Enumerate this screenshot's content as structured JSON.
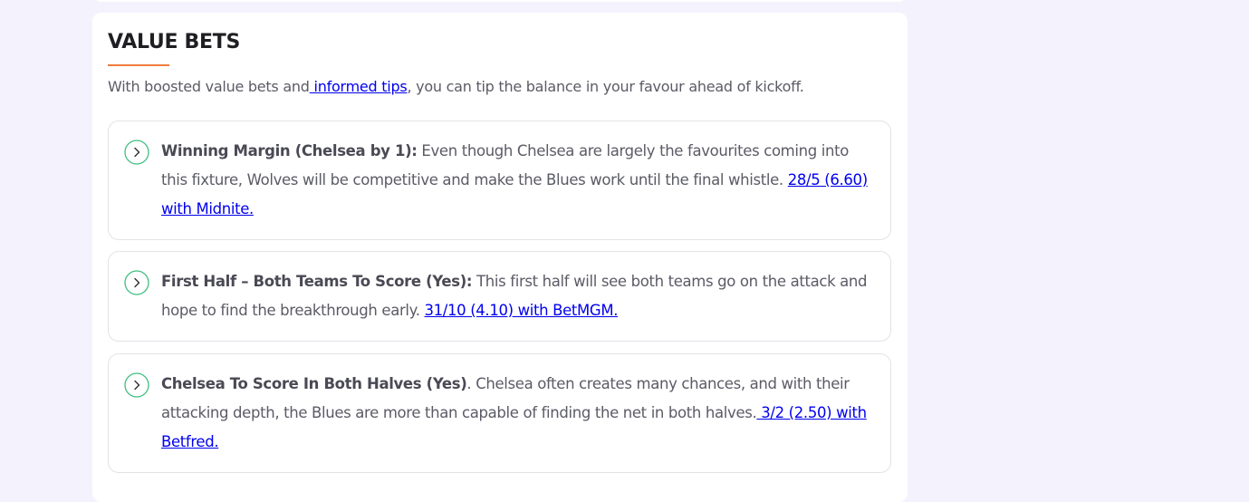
{
  "section": {
    "title": "VALUE BETS",
    "intro_before": "With boosted value bets and",
    "intro_link": " informed tips",
    "intro_after": ", you can tip the balance in your favour ahead of kickoff."
  },
  "tips": [
    {
      "icon": "chevron-right-icon",
      "heading": "Winning Margin (Chelsea by 1):",
      "body": " Even though Chelsea are largely the favourites coming into this fixture, Wolves will be competitive and make the Blues work until the final whistle. ",
      "link": "28/5 (6.60) with Midnite."
    },
    {
      "icon": "chevron-right-icon",
      "heading": "First Half – Both Teams To Score (Yes):",
      "body": " This first half will see both teams go on the attack and hope to find the breakthrough early. ",
      "link": "31/10 (4.10) with BetMGM. "
    },
    {
      "icon": "chevron-right-icon",
      "heading": "Chelsea To Score In Both Halves (Yes)",
      "body": ". Chelsea often creates many chances, and with their attacking depth, the Blues are more than capable of finding the net in both halves.",
      "link": " 3/2 (2.50) with Betfred. "
    }
  ],
  "colors": {
    "page_background": "#f4f3fd",
    "card_background": "#ffffff",
    "accent_underline": "#ef7d3c",
    "chevron_green": "#3fbf7f",
    "link": "#0000ee",
    "body_text": "#5b5b66",
    "heading_text": "#1f1f23"
  }
}
